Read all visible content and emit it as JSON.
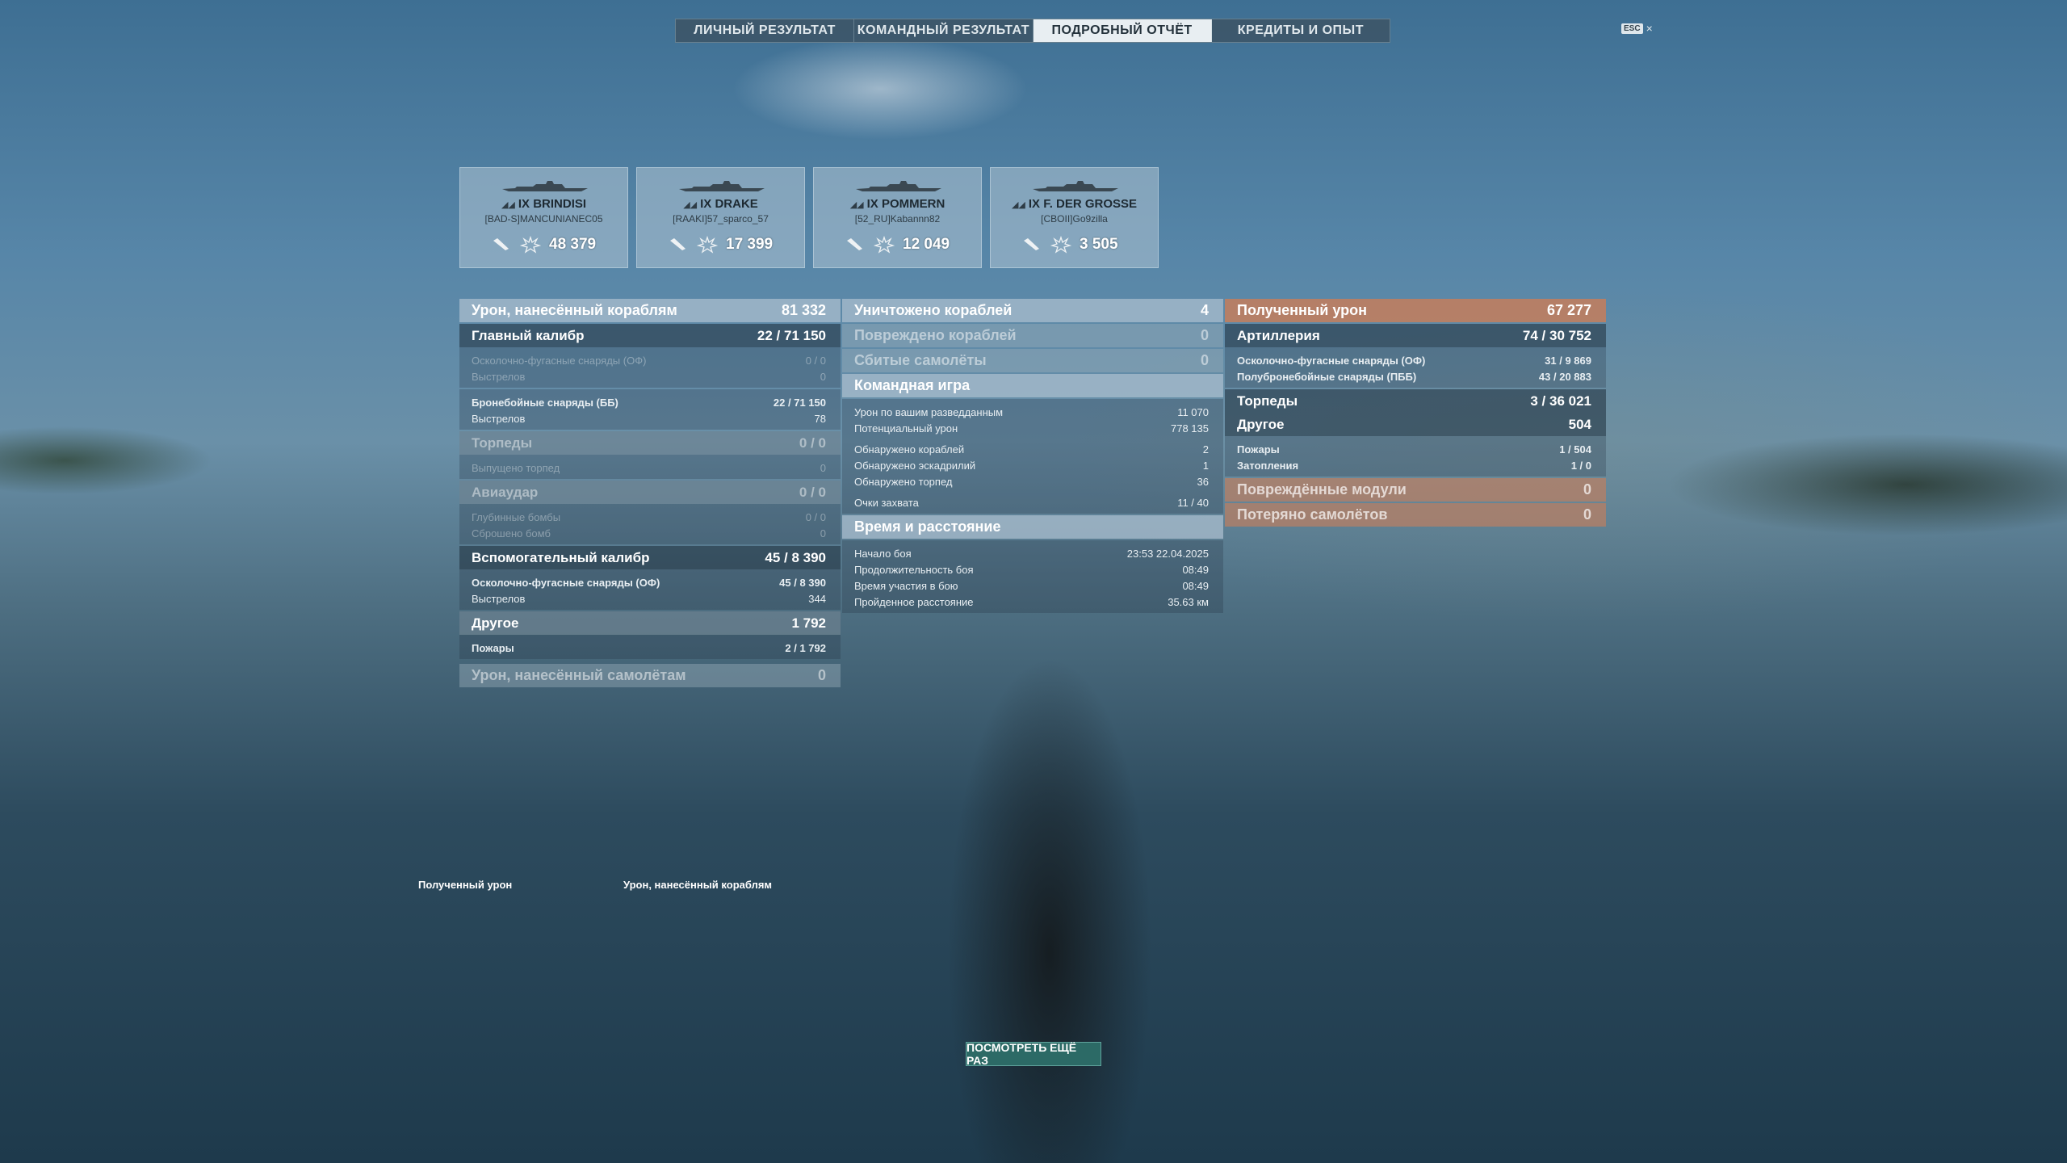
{
  "tabs": [
    "ЛИЧНЫЙ РЕЗУЛЬТАТ",
    "КОМАНДНЫЙ РЕЗУЛЬТАТ",
    "ПОДРОБНЫЙ ОТЧЁТ",
    "КРЕДИТЫ И ОПЫТ"
  ],
  "active_tab": "ПОДРОБНЫЙ ОТЧЁТ",
  "esc": {
    "badge": "ESC",
    "close": "×"
  },
  "ships": [
    {
      "tier_name": "IX BRINDISI",
      "player": "[BAD-S]MANCUNIANEC05",
      "damage": "48 379"
    },
    {
      "tier_name": "IX DRAKE",
      "player": "[RAAKI]57_sparco_57",
      "damage": "17 399"
    },
    {
      "tier_name": "IX POMMERN",
      "player": "[52_RU]Kabannn82",
      "damage": "12 049"
    },
    {
      "tier_name": "IX F. DER GROSSE",
      "player": "[CBOII]Go9zilla",
      "damage": "3 505"
    }
  ],
  "left": {
    "damage_ships": {
      "label": "Урон, нанесённый кораблям",
      "value": "81 332"
    },
    "main": {
      "label": "Главный калибр",
      "hits": "22 /",
      "dmg": "71 150"
    },
    "he_shells": {
      "label": "Осколочно-фугасные снаряды (ОФ)",
      "value": "0 / 0"
    },
    "he_shots": {
      "label": "Выстрелов",
      "value": "0"
    },
    "ap_shells": {
      "label": "Бронебойные снаряды (ББ)",
      "hits": "22 /",
      "dmg": "71 150"
    },
    "ap_shots": {
      "label": "Выстрелов",
      "value": "78"
    },
    "torps": {
      "label": "Торпеды",
      "value": "0 / 0"
    },
    "torps_launched": {
      "label": "Выпущено торпед",
      "value": "0"
    },
    "air": {
      "label": "Авиаудар",
      "value": "0 / 0"
    },
    "depth": {
      "label": "Глубинные бомбы",
      "value": "0 / 0"
    },
    "bombs": {
      "label": "Сброшено бомб",
      "value": "0"
    },
    "secondary": {
      "label": "Вспомогательный калибр",
      "hits": "45 /",
      "dmg": "8 390"
    },
    "sec_he": {
      "label": "Осколочно-фугасные снаряды (ОФ)",
      "hits": "45 /",
      "dmg": "8 390"
    },
    "sec_shots": {
      "label": "Выстрелов",
      "value": "344"
    },
    "other": {
      "label": "Другое",
      "value": "1 792"
    },
    "fires": {
      "label": "Пожары",
      "hits": "2 /",
      "dmg": "1 792"
    },
    "damage_planes": {
      "label": "Урон, нанесённый самолётам",
      "value": "0"
    }
  },
  "middle": {
    "destroyed": {
      "label": "Уничтожено кораблей",
      "value": "4"
    },
    "damaged": {
      "label": "Повреждено кораблей",
      "value": "0"
    },
    "planes_down": {
      "label": "Сбитые самолёты",
      "value": "0"
    },
    "team_play": "Командная игра",
    "spotting_dmg": {
      "label": "Урон по вашим разведданным",
      "value": "11 070"
    },
    "potential": {
      "label": "Потенциальный урон",
      "value": "778 135"
    },
    "spotted_ships": {
      "label": "Обнаружено кораблей",
      "value": "2"
    },
    "spotted_squads": {
      "label": "Обнаружено эскадрилий",
      "value": "1"
    },
    "spotted_torps": {
      "label": "Обнаружено торпед",
      "value": "36"
    },
    "capture": {
      "label": "Очки захвата",
      "value": "11 / 40"
    },
    "time_dist": "Время и расстояние",
    "start": {
      "label": "Начало боя",
      "value": "23:53  22.04.2025"
    },
    "duration": {
      "label": "Продолжительность боя",
      "value": "08:49"
    },
    "participation": {
      "label": "Время участия в бою",
      "value": "08:49"
    },
    "distance": {
      "label": "Пройденное расстояние",
      "value": "35.63 км"
    }
  },
  "right": {
    "received": {
      "label": "Полученный урон",
      "value": "67 277"
    },
    "artillery": {
      "label": "Артиллерия",
      "hits": "74 /",
      "dmg": "30 752"
    },
    "he": {
      "label": "Осколочно-фугасные снаряды (ОФ)",
      "hits": "31 /",
      "dmg": "9 869"
    },
    "sap": {
      "label": "Полубронебойные снаряды (ПББ)",
      "hits": "43 /",
      "dmg": "20 883"
    },
    "torps": {
      "label": "Торпеды",
      "hits": "3 /",
      "dmg": "36 021"
    },
    "other": {
      "label": "Другое",
      "value": "504"
    },
    "fires": {
      "label": "Пожары",
      "hits": "1 /",
      "dmg": "504"
    },
    "floods": {
      "label": "Затопления",
      "value": "1 / 0"
    },
    "modules": {
      "label": "Повреждённые модули",
      "value": "0"
    },
    "planes_lost": {
      "label": "Потеряно самолётов",
      "value": "0"
    }
  },
  "chart_labels": {
    "received": "Полученный урон",
    "dealt": "Урон, нанесённый кораблям"
  },
  "replay_button": "ПОСМОТРЕТЬ ЕЩЁ РАЗ"
}
